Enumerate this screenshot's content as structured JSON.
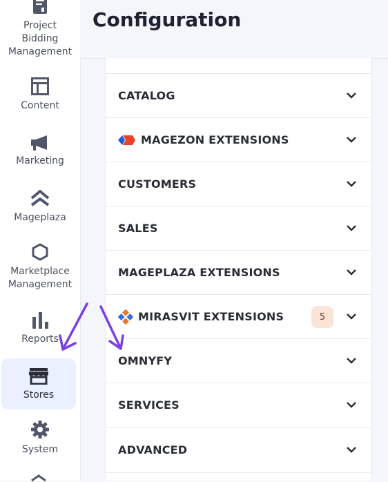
{
  "sidebar": {
    "items": [
      {
        "label": "Project Bidding Management",
        "line1": "Project",
        "line2": "Bidding",
        "line3": "Management",
        "icon": "document-icon"
      },
      {
        "label": "Content",
        "icon": "layout-icon"
      },
      {
        "label": "Marketing",
        "icon": "megaphone-icon"
      },
      {
        "label": "Mageplaza",
        "icon": "mageplaza-icon"
      },
      {
        "label": "Marketplace Management",
        "line1": "Marketplace",
        "line2": "Management",
        "icon": "hexagon-icon"
      },
      {
        "label": "Reports",
        "icon": "bar-chart-icon"
      },
      {
        "label": "Stores",
        "icon": "store-icon",
        "active": true
      },
      {
        "label": "System",
        "icon": "gear-icon"
      }
    ]
  },
  "header": {
    "title": "Configuration"
  },
  "config": {
    "rows": [
      {
        "label": "CATALOG"
      },
      {
        "label": "MAGEZON EXTENSIONS",
        "logo": "magezon-logo"
      },
      {
        "label": "CUSTOMERS"
      },
      {
        "label": "SALES"
      },
      {
        "label": "MAGEPLAZA EXTENSIONS"
      },
      {
        "label": "MIRASVIT EXTENSIONS",
        "logo": "mirasvit-logo",
        "badge": "5"
      },
      {
        "label": "OMNYFY"
      },
      {
        "label": "SERVICES"
      },
      {
        "label": "ADVANCED"
      }
    ]
  },
  "colors": {
    "accent_arrow": "#7b3fe4",
    "active_nav_bg": "#eaf0ff",
    "badge_bg": "#fbe4d6",
    "magezon_red": "#e9432a",
    "magezon_blue": "#2458d6",
    "mirasvit_orange": "#e8772e",
    "mirasvit_blue": "#3a6fd8"
  }
}
